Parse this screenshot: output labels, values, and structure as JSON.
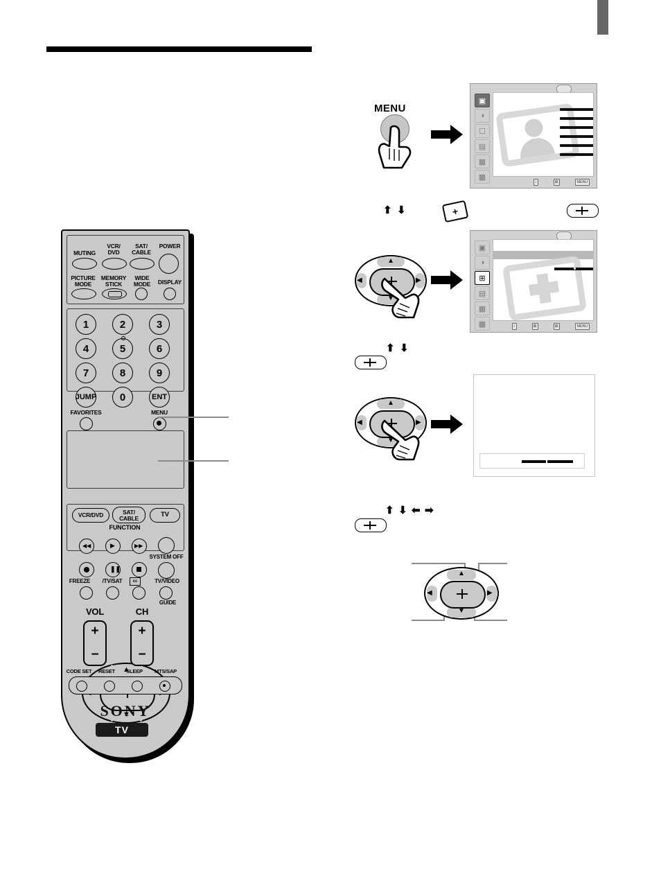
{
  "page": {
    "tab_marker_color": "#666666",
    "rule_color": "#000000"
  },
  "remote": {
    "brand": "SONY",
    "mode_badge": "TV",
    "rows": {
      "row1": [
        {
          "label": "MUTING",
          "shape": "oval"
        },
        {
          "label": "VCR/\nDVD",
          "shape": "oval"
        },
        {
          "label": "SAT/\nCABLE",
          "shape": "oval"
        },
        {
          "label": "POWER",
          "shape": "circle-large"
        }
      ],
      "row2": [
        {
          "label": "PICTURE\nMODE",
          "shape": "oval"
        },
        {
          "label": "MEMORY\nSTICK",
          "shape": "oval-ms"
        },
        {
          "label": "WIDE\nMODE",
          "shape": "circle"
        },
        {
          "label": "DISPLAY",
          "shape": "circle"
        }
      ],
      "keypad": [
        "1",
        "2",
        "3",
        "4",
        "5",
        "6",
        "7",
        "8",
        "9",
        "JUMP",
        "0",
        "ENT"
      ],
      "row_favorites_menu": [
        {
          "label": "FAVORITES",
          "shape": "circle"
        },
        {
          "label": "MENU",
          "shape": "circle-dot"
        }
      ],
      "function_row": [
        {
          "label": "VCR/DVD"
        },
        {
          "label": "SAT/\nCABLE"
        },
        {
          "label": "TV"
        }
      ],
      "function_caption": "FUNCTION",
      "transport": [
        "rew",
        "play",
        "ff",
        "system-off-circle"
      ],
      "transport2": [
        "rec",
        "pause",
        "stop",
        "tv-video-circle"
      ],
      "labels_row": [
        {
          "label": "SYSTEM OFF"
        },
        {
          "label": "TV/VIDEO"
        },
        {
          "label": "FREEZE"
        },
        {
          "label": "/TV/SAT"
        },
        {
          "label": "cc"
        },
        {
          "label": "GUIDE"
        }
      ],
      "rockers": [
        {
          "label": "VOL",
          "plus": "+",
          "minus": "−"
        },
        {
          "label": "CH",
          "plus": "+",
          "minus": "−"
        }
      ],
      "bottom_row": [
        "CODE SET",
        "RESET",
        "SLEEP",
        "MTS/SAP"
      ]
    }
  },
  "steps": [
    {
      "id": "step-1",
      "button_label": "MENU",
      "screen": {
        "sidebar_icons": [
          "picture-icon",
          "audio-icon",
          "memory-stick-icon",
          "channel-icon",
          "setup-icon",
          "options-icon"
        ],
        "selected_index": 0,
        "bottom_icons": [
          "updown-icon",
          "select-icon",
          "menu-icon"
        ],
        "bottom_menu_label": "MENU",
        "watermark": "person-card-watermark",
        "watermark_lines": 6
      }
    },
    {
      "id": "step-2",
      "glyphs": {
        "up": "⬆",
        "down": "⬇",
        "select": "+"
      },
      "card_icon": "memory-stick-card-icon",
      "screen": {
        "sidebar_icons": [
          "picture-icon",
          "audio-icon",
          "memory-stick-icon",
          "channel-icon",
          "setup-icon",
          "options-icon"
        ],
        "selected_index": 2,
        "bottom_icons": [
          "updown-icon",
          "enter-icon",
          "select-icon",
          "menu-icon"
        ],
        "bottom_menu_label": "MENU",
        "watermark": "plus-card-watermark"
      }
    },
    {
      "id": "step-3",
      "glyphs": {
        "up": "⬆",
        "down": "⬇",
        "select": "+"
      },
      "screen": {
        "type": "blank-with-bottom-bar"
      }
    },
    {
      "id": "step-4",
      "glyphs": {
        "up": "⬆",
        "down": "⬇",
        "left": "⬅",
        "right": "➡",
        "select": "+"
      },
      "dpad_callouts": 4
    }
  ]
}
